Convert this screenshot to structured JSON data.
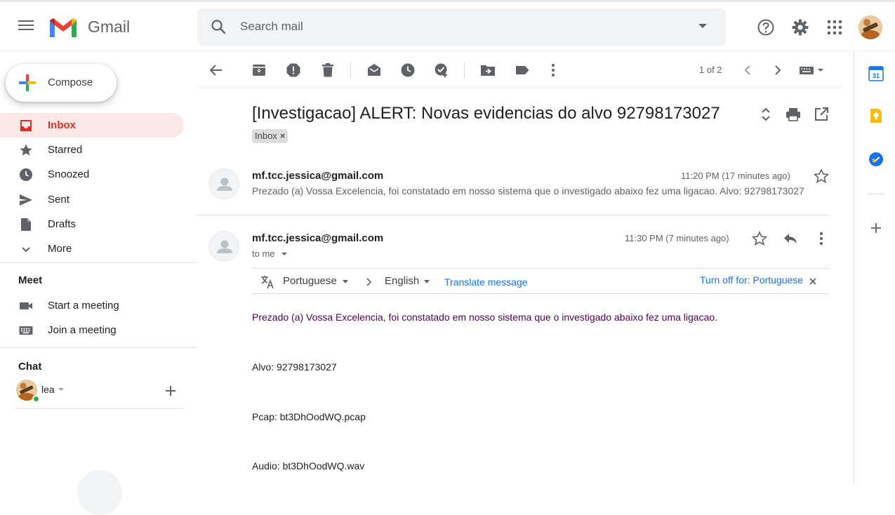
{
  "app": {
    "name": "Gmail"
  },
  "search": {
    "placeholder": "Search mail"
  },
  "compose": {
    "label": "Compose"
  },
  "nav": [
    {
      "label": "Inbox",
      "icon": "inbox-icon",
      "active": true
    },
    {
      "label": "Starred",
      "icon": "star-icon"
    },
    {
      "label": "Snoozed",
      "icon": "clock-icon"
    },
    {
      "label": "Sent",
      "icon": "send-icon"
    },
    {
      "label": "Drafts",
      "icon": "draft-icon"
    },
    {
      "label": "More",
      "icon": "chevron-down-icon"
    }
  ],
  "meet": {
    "heading": "Meet",
    "items": [
      {
        "label": "Start a meeting",
        "icon": "video-icon"
      },
      {
        "label": "Join a meeting",
        "icon": "keyboard-icon"
      }
    ]
  },
  "chat": {
    "heading": "Chat",
    "user": "lea"
  },
  "toolbar": {
    "pager": "1 of 2"
  },
  "thread": {
    "subject": "[Investigacao] ALERT: Novas evidencias do alvo 92798173027",
    "label": "Inbox",
    "label_remove": "×",
    "messages": [
      {
        "sender": "mf.tcc.jessica@gmail.com",
        "time": "11:20 PM (17 minutes ago)",
        "snippet": "Prezado (a) Vossa Excelencia, foi constatado em nosso sistema que o investigado abaixo fez uma ligacao. Alvo: 92798173027"
      },
      {
        "sender": "mf.tcc.jessica@gmail.com",
        "time": "11:30 PM (7 minutes ago)",
        "to": "to me"
      }
    ],
    "translate": {
      "from": "Portuguese",
      "to": "English",
      "action": "Translate message",
      "turn_off": "Turn off for: Portuguese"
    },
    "body": {
      "greeting": "Prezado (a) Vossa Excelencia, foi constatado em nosso sistema que o investigado abaixo fez uma ligacao.",
      "alvo": "Alvo: 92798173027",
      "pcap": "Pcap: bt3DhOodWQ.pcap",
      "audio": "Audio: bt3DhOodWQ.wav"
    }
  },
  "colors": {
    "accent_red": "#d93025",
    "link_blue": "#1a73e8",
    "active_bg": "#fce8e6",
    "body_purple": "#500050"
  }
}
